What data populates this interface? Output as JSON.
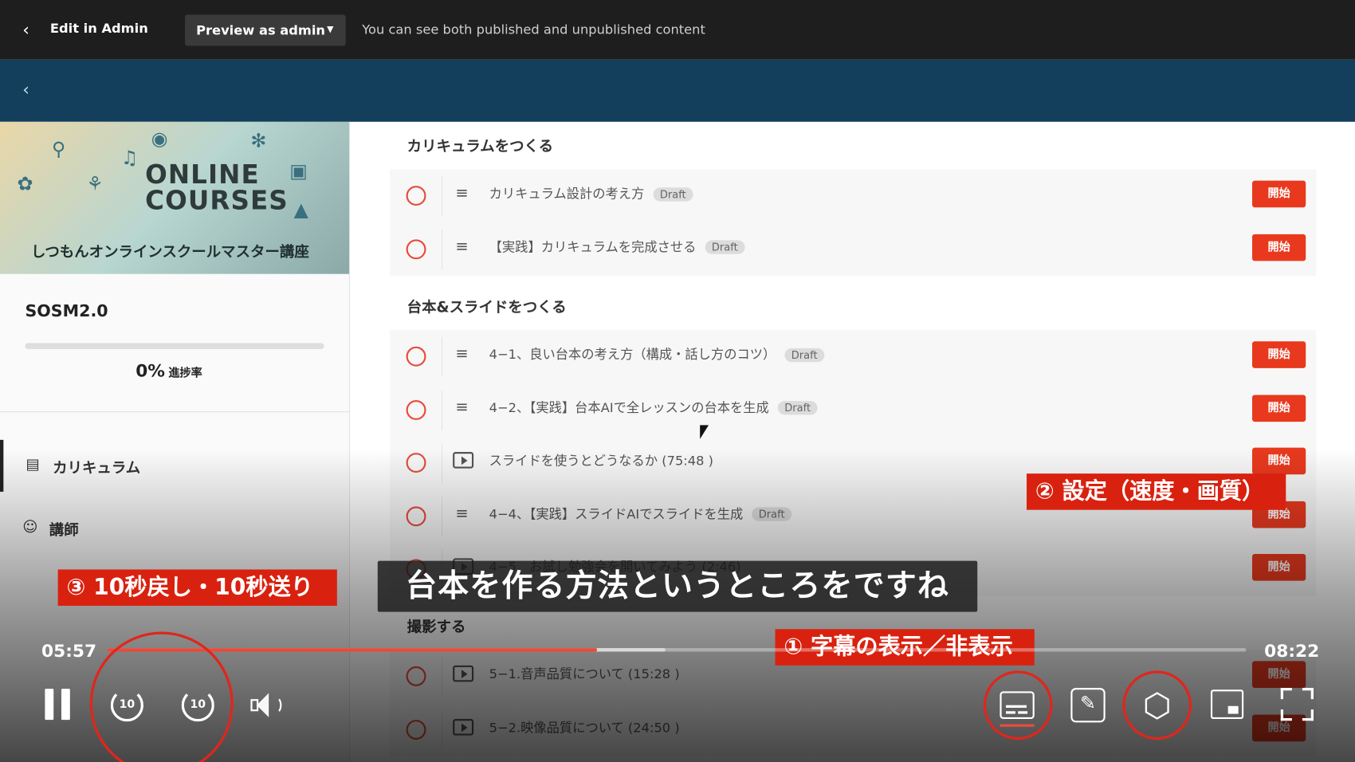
{
  "admin_bar": {
    "back_label": "Edit in Admin",
    "preview_button": "Preview as admin",
    "note": "You can see both published and unpublished content"
  },
  "sidebar": {
    "banner": {
      "line1": "ONLINE",
      "line2": "COURSES",
      "line3": "しつもんオンラインスクールマスター講座"
    },
    "course_title": "SOSM2.0",
    "progress": {
      "percent": 0,
      "percent_text": "0%",
      "label": "進捗率"
    },
    "nav": [
      {
        "label": "カリキュラム",
        "icon": "curriculum-icon",
        "active": true
      },
      {
        "label": "講師",
        "icon": "person-icon",
        "active": false
      }
    ]
  },
  "main": {
    "sections": [
      {
        "title": "カリキュラムをつくる",
        "rows": [
          {
            "type": "text",
            "title": "カリキュラム設計の考え方",
            "draft": "Draft",
            "start": "開始"
          },
          {
            "type": "text",
            "title": "【実践】カリキュラムを完成させる",
            "draft": "Draft",
            "start": "開始"
          }
        ]
      },
      {
        "title": "台本&スライドをつくる",
        "rows": [
          {
            "type": "text",
            "title": "4−1、良い台本の考え方（構成・話し方のコツ）",
            "draft": "Draft",
            "start": "開始"
          },
          {
            "type": "text",
            "title": "4−2、【実践】台本AIで全レッスンの台本を生成",
            "draft": "Draft",
            "start": "開始"
          },
          {
            "type": "video",
            "title": "スライドを使うとどうなるか (75:48 )",
            "draft": "",
            "start": "開始"
          },
          {
            "type": "text",
            "title": "4−4、【実践】スライドAIでスライドを生成",
            "draft": "Draft",
            "start": "開始"
          },
          {
            "type": "video",
            "title": "4−5、お試し勉強会を開いてみよう (2:46)",
            "draft": "",
            "start": "開始"
          }
        ]
      },
      {
        "title": "撮影する",
        "rows": [
          {
            "type": "video",
            "title": "5−1.音声品質について (15:28 )",
            "draft": "",
            "start": "開始"
          },
          {
            "type": "video",
            "title": "5−2.映像品質について (24:50 )",
            "draft": "",
            "start": "開始"
          }
        ]
      }
    ]
  },
  "player": {
    "subtitle": "台本を作る方法というところをですね",
    "current_time": "05:57",
    "duration": "08:22",
    "played_fraction": 0.43,
    "buffered_fraction": 0.49,
    "skip_back": "10",
    "skip_forward": "10"
  },
  "callouts": {
    "settings": "② 設定（速度・画質）",
    "skip": "③ 10秒戻し・10秒送り",
    "captions": "① 字幕の表示／非表示"
  },
  "colors": {
    "accent_red": "#e8391e",
    "header_blue": "#133f5c",
    "admin_bar": "#1e1e1e"
  }
}
